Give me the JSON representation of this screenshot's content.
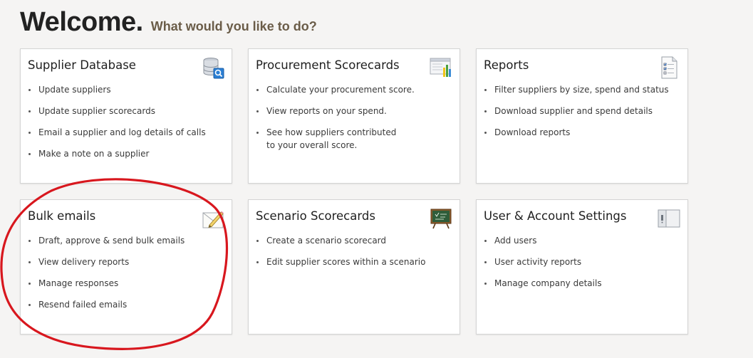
{
  "header": {
    "title": "Welcome.",
    "subtitle": "What would you like to do?"
  },
  "colors": {
    "annotation": "#d8171e",
    "subtitle": "#6a5c48"
  },
  "cards": [
    {
      "title": "Supplier Database",
      "icon": "database-search-icon",
      "items": [
        "Update suppliers",
        "Update supplier scorecards",
        "Email a supplier and log details of calls",
        "Make a note on a supplier"
      ]
    },
    {
      "title": "Procurement Scorecards",
      "icon": "bar-chart-icon",
      "items": [
        "Calculate your procurement score.",
        "View reports on your spend.",
        "See how suppliers contributed\nto your overall score."
      ]
    },
    {
      "title": "Reports",
      "icon": "report-checklist-icon",
      "items": [
        "Filter suppliers by size, spend and status",
        "Download supplier and spend details",
        "Download reports"
      ]
    },
    {
      "title": "Bulk emails",
      "icon": "compose-email-icon",
      "items": [
        "Draft, approve & send bulk emails",
        "View delivery reports",
        "Manage responses",
        "Resend failed emails"
      ]
    },
    {
      "title": "Scenario Scorecards",
      "icon": "chalkboard-icon",
      "items": [
        "Create a scenario scorecard",
        "Edit supplier scores within a scenario"
      ]
    },
    {
      "title": "User & Account Settings",
      "icon": "settings-panel-icon",
      "items": [
        "Add users",
        "User activity reports",
        "Manage company details"
      ]
    }
  ]
}
